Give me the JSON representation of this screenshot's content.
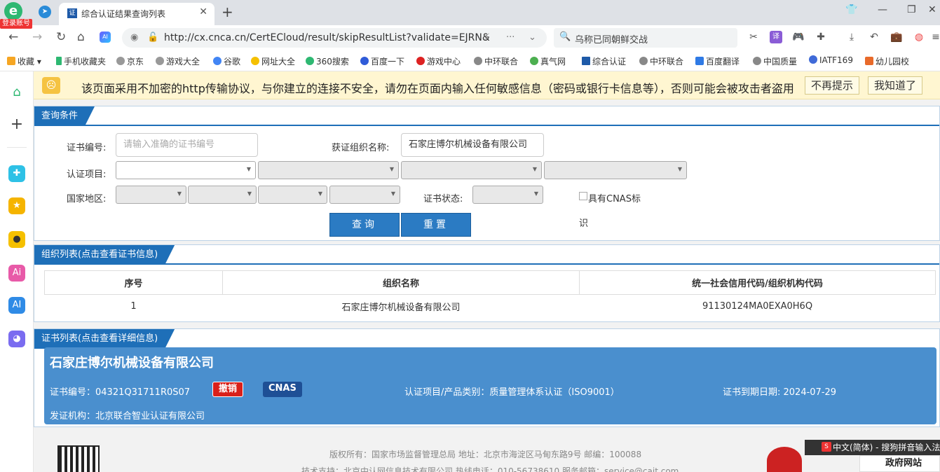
{
  "browser": {
    "login_badge": "登录账号",
    "tab_title": "综合认证结果查询列表",
    "url": "http://cx.cnca.cn/CertECloud/result/skipResultList?validate=EJRN&",
    "search_text": "乌称已同朝鲜交战",
    "bookmarks": [
      "收藏",
      "手机收藏夹",
      "京东",
      "游戏大全",
      "谷歌",
      "网址大全",
      "360搜索",
      "百度一下",
      "游戏中心",
      "中环联合",
      "真气网",
      "综合认证",
      "中环联合",
      "百度翻译",
      "中国质量",
      "IATF169",
      "幼儿园校"
    ]
  },
  "warning": {
    "text": "该页面采用不加密的http传输协议，与你建立的连接不安全，请勿在页面内输入任何敏感信息（密码或银行卡信息等），否则可能会被攻击者盗用",
    "btn_dismiss": "不再提示",
    "btn_ok": "我知道了"
  },
  "query": {
    "title": "查询条件",
    "cert_no_label": "证书编号:",
    "cert_no_placeholder": "请输入准确的证书编号",
    "org_label": "获证组织名称:",
    "org_value": "石家庄博尔机械设备有限公司",
    "project_label": "认证项目:",
    "region_label": "国家地区:",
    "status_label": "证书状态:",
    "cnas_label_1": "具有CNAS标",
    "cnas_label_2": "识",
    "btn_query": "查询",
    "btn_reset": "重置"
  },
  "orgs": {
    "title": "组织列表(点击查看证书信息)",
    "headers": [
      "序号",
      "组织名称",
      "统一社会信用代码/组织机构代码"
    ],
    "rows": [
      {
        "no": "1",
        "name": "石家庄博尔机械设备有限公司",
        "code": "91130124MA0EXA0H6Q"
      }
    ]
  },
  "certs": {
    "title": "证书列表(点击查看详细信息)",
    "company": "石家庄博尔机械设备有限公司",
    "cert_no": "证书编号：04321Q31711R0S07",
    "status_badge": "撤销",
    "cnas_badge": "CNAS",
    "project": "认证项目/产品类别：质量管理体系认证（ISO9001）",
    "expiry": "证书到期日期: 2024-07-29",
    "issuer": "发证机构：北京联合智业认证有限公司"
  },
  "footer": {
    "line1": "版权所有：国家市场监督管理总局    地址：北京市海淀区马甸东路9号    邮编：100088",
    "line2": "技术支持：北京中认网信息技术有限公司    热线电话：010-56738610    服务邮箱：service@cait.com",
    "gov_label": "政府网站"
  },
  "ime": "中文(简体) - 搜狗拼音输入法",
  "colors": {
    "accent": "#1e6fb8",
    "card": "#4a8fce",
    "revoked": "#d9201a",
    "cnas": "#1e4f95"
  }
}
